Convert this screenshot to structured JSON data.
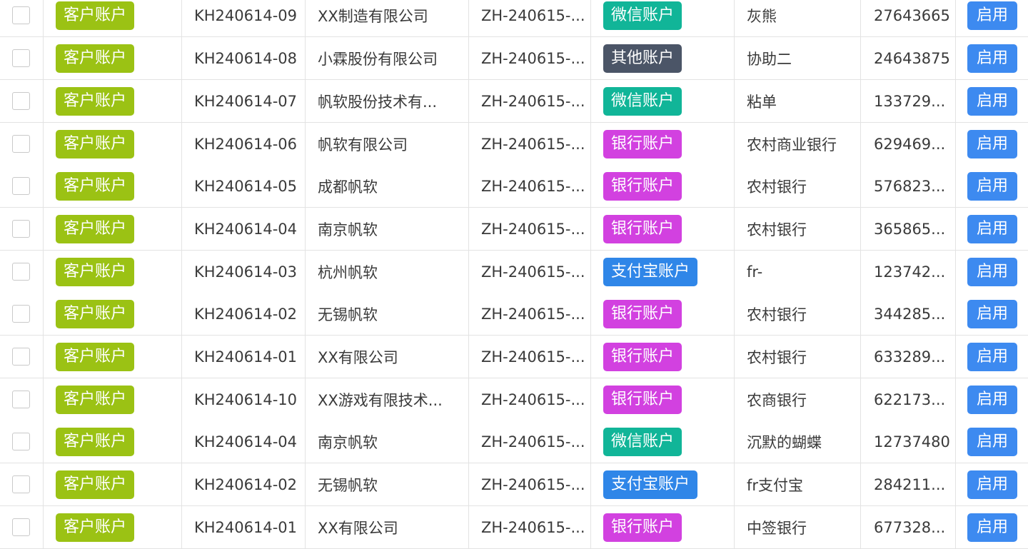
{
  "colors": {
    "customer_tag": "#9bc214",
    "wechat": "#11b598",
    "other": "#4b5567",
    "bank": "#d241e0",
    "alipay": "#2f86e8",
    "enable_button": "#3d8af0",
    "grid_line": "#e3e3e3"
  },
  "rows": [
    {
      "type_label": "客户账户",
      "code": "KH240614-09",
      "name": "XX制造有限公司",
      "account": "ZH-240615-...",
      "kind_label": "微信账户",
      "kind": "wechat",
      "bank": "灰熊",
      "number": "27643665",
      "action_label": "启用"
    },
    {
      "type_label": "客户账户",
      "code": "KH240614-08",
      "name": "小霖股份有限公司",
      "account": "ZH-240615-...",
      "kind_label": "其他账户",
      "kind": "other",
      "bank": "协助二",
      "number": "24643875",
      "action_label": "启用"
    },
    {
      "type_label": "客户账户",
      "code": "KH240614-07",
      "name": "帆软股份技术有...",
      "account": "ZH-240615-...",
      "kind_label": "微信账户",
      "kind": "wechat",
      "bank": "粘单",
      "number": "133729...",
      "action_label": "启用"
    },
    {
      "type_label": "客户账户",
      "code": "KH240614-06",
      "name": "帆软有限公司",
      "account": "ZH-240615-...",
      "kind_label": "银行账户",
      "kind": "bank",
      "bank": "农村商业银行",
      "number": "629469...",
      "action_label": "启用"
    },
    {
      "type_label": "客户账户",
      "code": "KH240614-05",
      "name": "成都帆软",
      "account": "ZH-240615-...",
      "kind_label": "银行账户",
      "kind": "bank",
      "bank": "农村银行",
      "number": "576823...",
      "action_label": "启用"
    },
    {
      "type_label": "客户账户",
      "code": "KH240614-04",
      "name": "南京帆软",
      "account": "ZH-240615-...",
      "kind_label": "银行账户",
      "kind": "bank",
      "bank": "农村银行",
      "number": "365865...",
      "action_label": "启用"
    },
    {
      "type_label": "客户账户",
      "code": "KH240614-03",
      "name": "杭州帆软",
      "account": "ZH-240615-...",
      "kind_label": "支付宝账户",
      "kind": "alipay",
      "bank": "fr-",
      "number": "123742...",
      "action_label": "启用"
    },
    {
      "type_label": "客户账户",
      "code": "KH240614-02",
      "name": "无锡帆软",
      "account": "ZH-240615-...",
      "kind_label": "银行账户",
      "kind": "bank",
      "bank": "农村银行",
      "number": "344285...",
      "action_label": "启用"
    },
    {
      "type_label": "客户账户",
      "code": "KH240614-01",
      "name": "XX有限公司",
      "account": "ZH-240615-...",
      "kind_label": "银行账户",
      "kind": "bank",
      "bank": "农村银行",
      "number": "633289...",
      "action_label": "启用"
    },
    {
      "type_label": "客户账户",
      "code": "KH240614-10",
      "name": "XX游戏有限技术...",
      "account": "ZH-240615-...",
      "kind_label": "银行账户",
      "kind": "bank",
      "bank": "农商银行",
      "number": "622173...",
      "action_label": "启用"
    },
    {
      "type_label": "客户账户",
      "code": "KH240614-04",
      "name": "南京帆软",
      "account": "ZH-240615-...",
      "kind_label": "微信账户",
      "kind": "wechat",
      "bank": "沉默的蝴蝶",
      "number": "12737480",
      "action_label": "启用"
    },
    {
      "type_label": "客户账户",
      "code": "KH240614-02",
      "name": "无锡帆软",
      "account": "ZH-240615-...",
      "kind_label": "支付宝账户",
      "kind": "alipay",
      "bank": "fr支付宝",
      "number": "284211...",
      "action_label": "启用"
    },
    {
      "type_label": "客户账户",
      "code": "KH240614-01",
      "name": "XX有限公司",
      "account": "ZH-240615-...",
      "kind_label": "银行账户",
      "kind": "bank",
      "bank": "中签银行",
      "number": "677328...",
      "action_label": "启用"
    }
  ]
}
